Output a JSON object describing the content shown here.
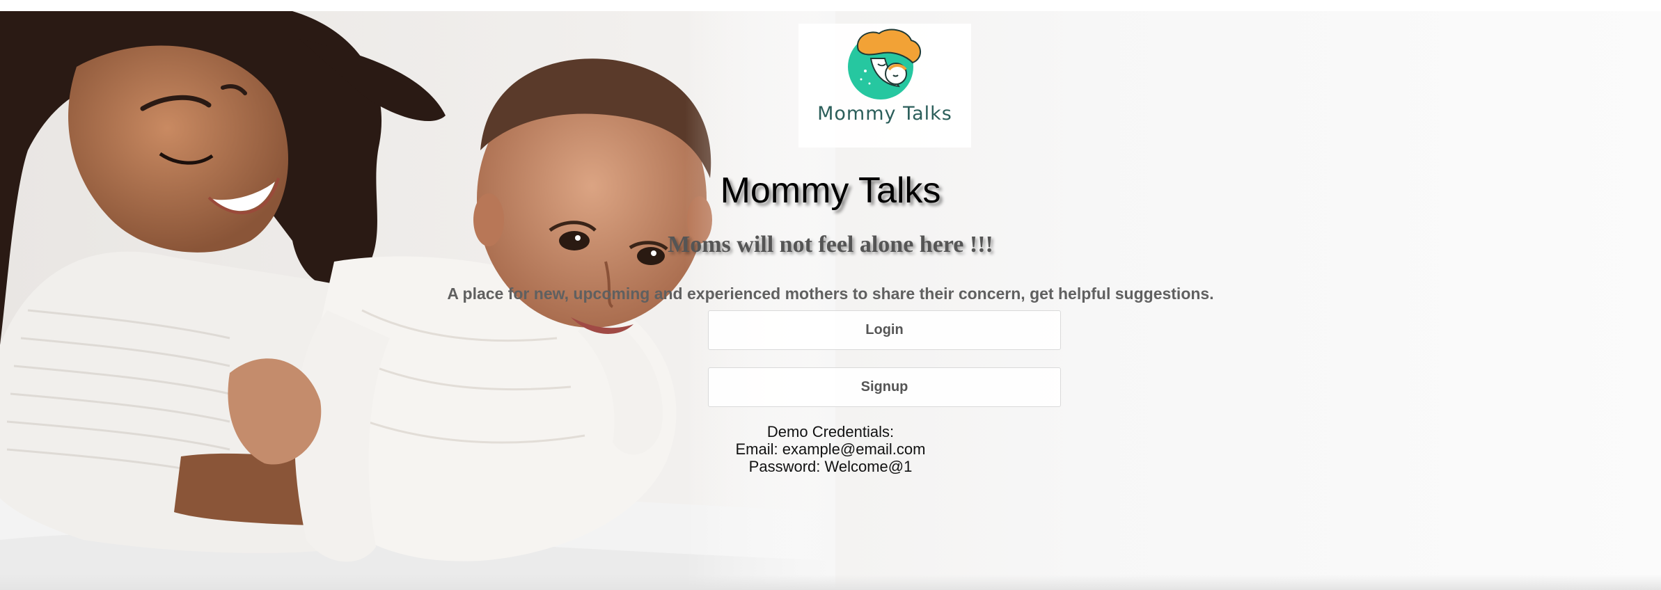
{
  "logo": {
    "text": "Mommy Talks",
    "colors": {
      "hair": "#f2a236",
      "circle": "#26c7a0",
      "text": "#2b5e5a"
    }
  },
  "hero": {
    "title": "Mommy Talks",
    "tagline": "Moms will not feel alone here !!!",
    "description": "A place for new, upcoming and experienced mothers to share their concern, get helpful suggestions."
  },
  "actions": {
    "login_label": "Login",
    "signup_label": "Signup"
  },
  "demo": {
    "heading": "Demo Credentials:",
    "email_line": "Email: example@email.com",
    "password_line": "Password: Welcome@1"
  }
}
